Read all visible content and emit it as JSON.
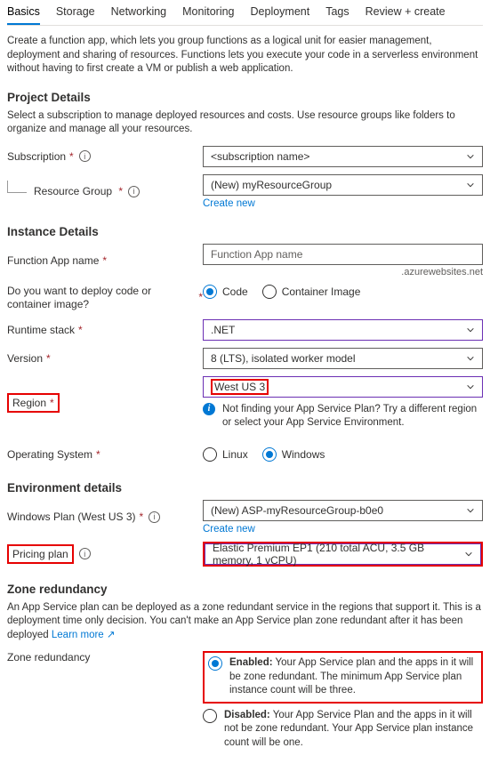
{
  "tabs": {
    "basics": "Basics",
    "storage": "Storage",
    "networking": "Networking",
    "monitoring": "Monitoring",
    "deployment": "Deployment",
    "tags": "Tags",
    "review": "Review + create"
  },
  "intro": "Create a function app, which lets you group functions as a logical unit for easier management, deployment and sharing of resources. Functions lets you execute your code in a serverless environment without having to first create a VM or publish a web application.",
  "project": {
    "title": "Project Details",
    "desc": "Select a subscription to manage deployed resources and costs. Use resource groups like folders to organize and manage all your resources.",
    "subscription_label": "Subscription",
    "subscription_value": "<subscription name>",
    "resource_group_label": "Resource Group",
    "resource_group_value": "(New) myResourceGroup",
    "create_new": "Create new"
  },
  "instance": {
    "title": "Instance Details",
    "name_label": "Function App name",
    "name_placeholder": "Function App name",
    "domain_suffix": ".azurewebsites.net",
    "deploy_label": "Do you want to deploy code or container image?",
    "deploy_code": "Code",
    "deploy_container": "Container Image",
    "runtime_label": "Runtime stack",
    "runtime_value": ".NET",
    "version_label": "Version",
    "version_value": "8 (LTS), isolated worker model",
    "region_label": "Region",
    "region_value": "West US 3",
    "region_hint": "Not finding your App Service Plan? Try a different region or select your App Service Environment.",
    "os_label": "Operating System",
    "os_linux": "Linux",
    "os_windows": "Windows"
  },
  "env": {
    "title": "Environment details",
    "plan_label": "Windows Plan (West US 3)",
    "plan_value": "(New) ASP-myResourceGroup-b0e0",
    "create_new": "Create new",
    "pricing_label": "Pricing plan",
    "pricing_value": "Elastic Premium EP1 (210 total ACU, 3.5 GB memory, 1 vCPU)"
  },
  "zone": {
    "title": "Zone redundancy",
    "desc": "An App Service plan can be deployed as a zone redundant service in the regions that support it. This is a deployment time only decision. You can't make an App Service plan zone redundant after it has been deployed",
    "learn_more": "Learn more",
    "label": "Zone redundancy",
    "enabled_title": "Enabled:",
    "enabled_desc": " Your App Service plan and the apps in it will be zone redundant. The minimum App Service plan instance count will be three.",
    "disabled_title": "Disabled:",
    "disabled_desc": " Your App Service Plan and the apps in it will not be zone redundant. Your App Service plan instance count will be one."
  }
}
